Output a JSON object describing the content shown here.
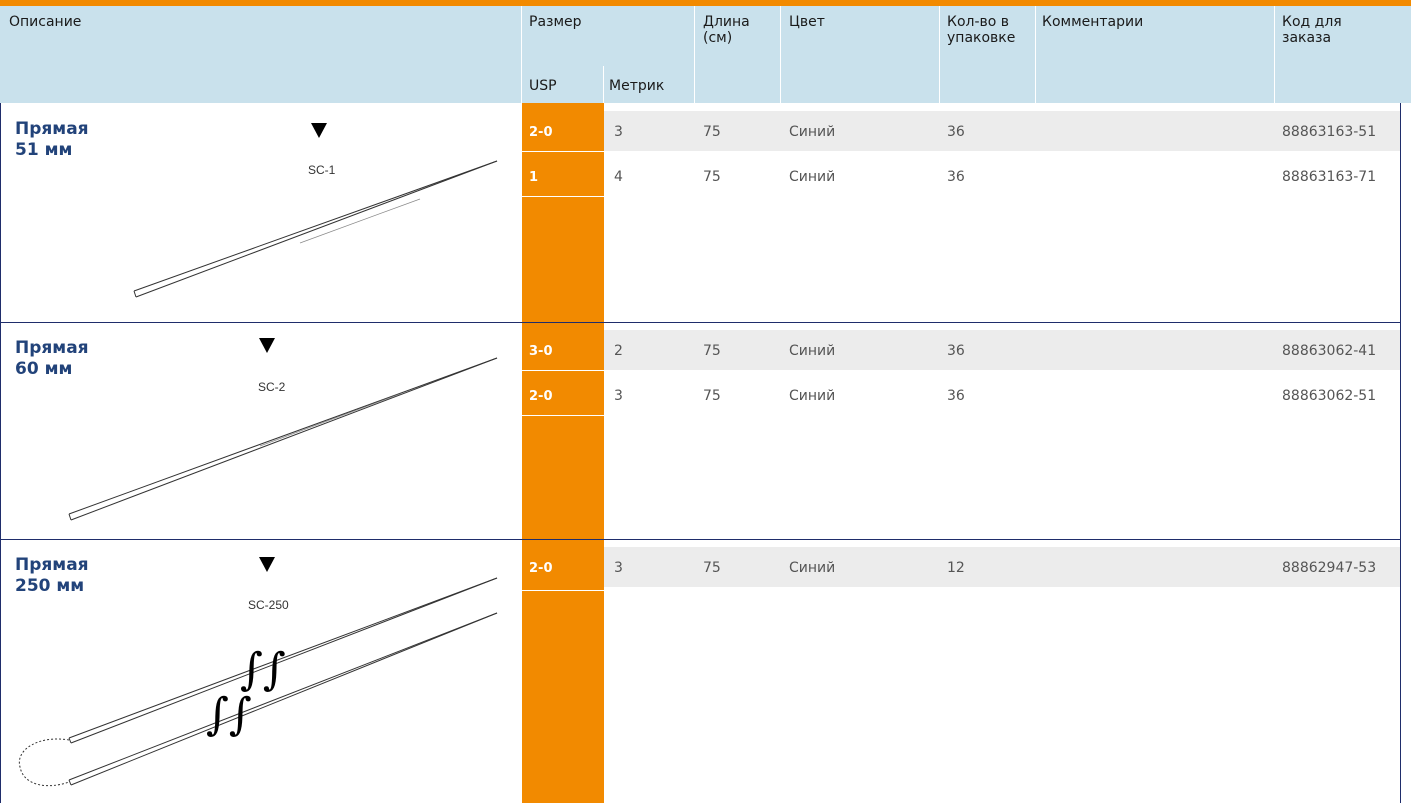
{
  "header": {
    "description": "Описание",
    "size": "Размер",
    "usp": "USP",
    "metric": "Метрик",
    "length": "Длина (см)",
    "color": "Цвет",
    "qty": "Кол-во в упаковке",
    "comments": "Комментарии",
    "order_code": "Код для заказа"
  },
  "groups": [
    {
      "title_line1": "Прямая",
      "title_line2": "51 мм",
      "needle_code": "SC-1",
      "needle_icon": "straight-needle",
      "rows": [
        {
          "usp": "2-0",
          "metric": "3",
          "length": "75",
          "color": "Синий",
          "qty": "36",
          "comment": "",
          "code": "88863163-51"
        },
        {
          "usp": "1",
          "metric": "4",
          "length": "75",
          "color": "Синий",
          "qty": "36",
          "comment": "",
          "code": "88863163-71"
        }
      ]
    },
    {
      "title_line1": "Прямая",
      "title_line2": "60 мм",
      "needle_code": "SC-2",
      "needle_icon": "straight-needle",
      "rows": [
        {
          "usp": "3-0",
          "metric": "2",
          "length": "75",
          "color": "Синий",
          "qty": "36",
          "comment": "",
          "code": "88863062-41"
        },
        {
          "usp": "2-0",
          "metric": "3",
          "length": "75",
          "color": "Синий",
          "qty": "36",
          "comment": "",
          "code": "88863062-51"
        }
      ]
    },
    {
      "title_line1": "Прямая",
      "title_line2": "250 мм",
      "needle_code": "SC-250",
      "needle_icon": "long-double-needle-loop",
      "rows": [
        {
          "usp": "2-0",
          "metric": "3",
          "length": "75",
          "color": "Синий",
          "qty": "12",
          "comment": "",
          "code": "88862947-53"
        }
      ]
    }
  ],
  "colors": {
    "accent": "#f28a00",
    "header_bg": "#c9e1ec",
    "title_blue": "#22437a",
    "separator": "#1f2d6b",
    "row_stripe": "#ececec"
  }
}
